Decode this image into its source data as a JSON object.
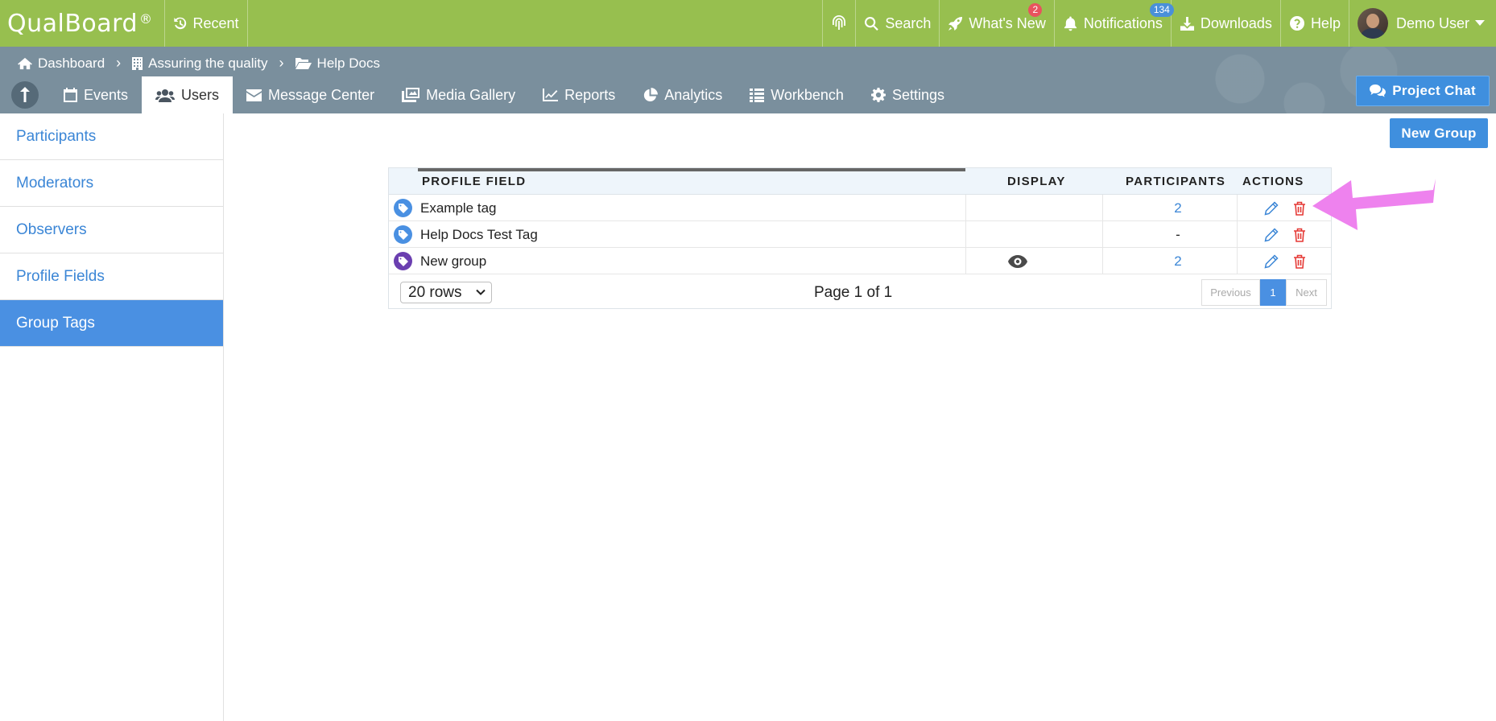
{
  "topbar": {
    "logo": "QualBoard",
    "logo_mark": "®",
    "recent": "Recent",
    "search": "Search",
    "whats_new": "What's New",
    "whats_new_badge": "2",
    "notifications": "Notifications",
    "notifications_badge": "134",
    "downloads": "Downloads",
    "help": "Help",
    "user": "Demo User"
  },
  "breadcrumb": [
    "Dashboard",
    "Assuring the quality",
    "Help Docs"
  ],
  "tabs": [
    "Events",
    "Users",
    "Message Center",
    "Media Gallery",
    "Reports",
    "Analytics",
    "Workbench",
    "Settings"
  ],
  "project_chat": "Project Chat",
  "sidebar": [
    "Participants",
    "Moderators",
    "Observers",
    "Profile Fields",
    "Group Tags"
  ],
  "new_group": "New Group",
  "table": {
    "headers": [
      "PROFILE FIELD",
      "DISPLAY",
      "PARTICIPANTS",
      "ACTIONS"
    ],
    "rows": [
      {
        "name": "Example tag",
        "participants": "2",
        "display": false,
        "color": "#4a90e2"
      },
      {
        "name": "Help Docs Test Tag",
        "participants": "-",
        "display": false,
        "color": "#4a90e2"
      },
      {
        "name": "New group",
        "participants": "2",
        "display": true,
        "color": "#6b3fb0"
      }
    ]
  },
  "pager": {
    "rows": "20 rows",
    "info": "Page 1 of 1",
    "previous": "Previous",
    "current": "1",
    "next": "Next"
  },
  "colors": {
    "topbar": "#97bf4f",
    "navbar": "#7a8f9d",
    "accent": "#4a90e2",
    "delete": "#e53935",
    "annotation_arrow": "#ee82ee"
  }
}
